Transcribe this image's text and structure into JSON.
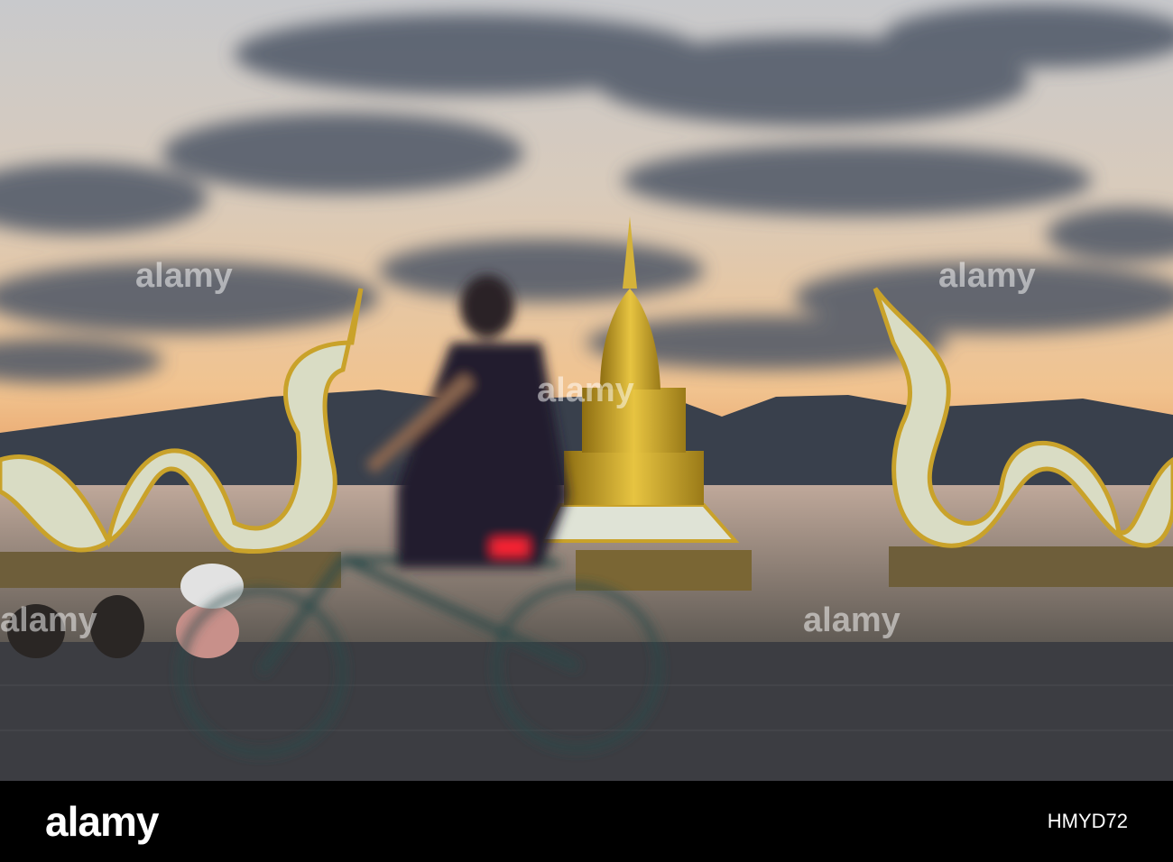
{
  "watermark": {
    "brand": "alamy"
  },
  "footer": {
    "logo": "alamy",
    "image_code": "HMYD72"
  },
  "colors": {
    "sky_top": "#5b6a7c",
    "sky_horizon": "#f3c89a",
    "gold": "#c9a22a",
    "water": "#7d766e",
    "promenade": "#3a3b3f"
  }
}
